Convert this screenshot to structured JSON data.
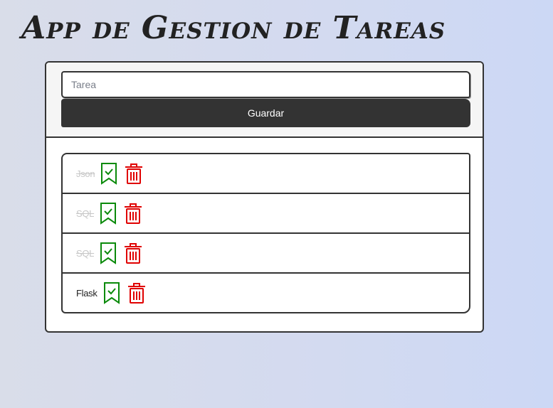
{
  "app": {
    "title": "App de Gestion de Tareas"
  },
  "form": {
    "input_placeholder": "Tarea",
    "input_value": "",
    "save_label": "Guardar"
  },
  "tasks": [
    {
      "name": "Json",
      "done": true
    },
    {
      "name": "SQL",
      "done": true
    },
    {
      "name": "SQL",
      "done": true
    },
    {
      "name": "Flask",
      "done": false
    }
  ],
  "icons": {
    "complete": "bookmark-check-icon",
    "delete": "trash-icon"
  },
  "colors": {
    "complete": "#0a8a0a",
    "delete": "#e00000",
    "button_bg": "#333333"
  }
}
